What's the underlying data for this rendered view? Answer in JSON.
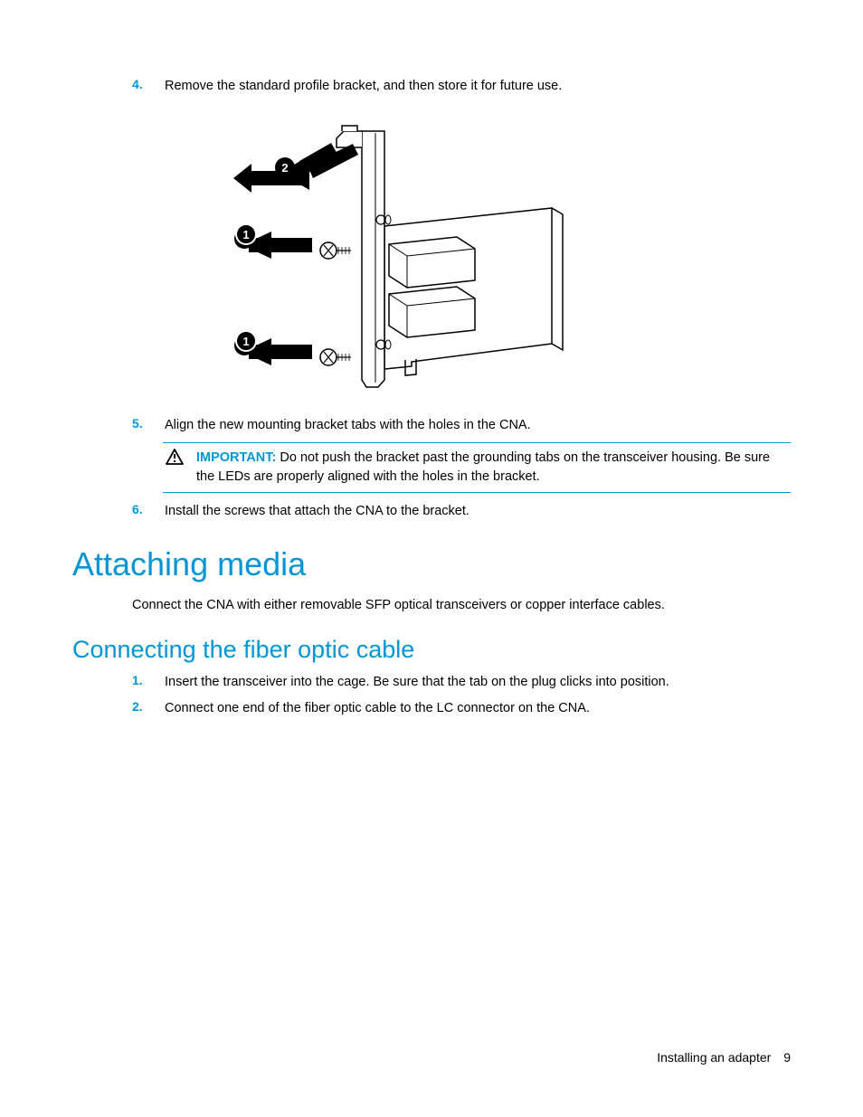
{
  "steps": {
    "step4": {
      "number": "4.",
      "text": "Remove the standard profile bracket, and then store it for future use."
    },
    "step5": {
      "number": "5.",
      "text": "Align the new mounting bracket tabs with the holes in the CNA."
    },
    "step6": {
      "number": "6.",
      "text": "Install the screws that attach the CNA to the bracket."
    }
  },
  "note": {
    "label": "IMPORTANT:",
    "text": "Do not push the bracket past the grounding tabs on the transceiver housing. Be sure the LEDs are properly aligned with the holes in the bracket."
  },
  "heading1": "Attaching media",
  "body1": "Connect the CNA with either removable SFP optical transceivers or copper interface cables.",
  "heading2": "Connecting the fiber optic cable",
  "substeps": {
    "step1": {
      "number": "1.",
      "text": "Insert the transceiver into the cage. Be sure that the tab on the plug clicks into position."
    },
    "step2": {
      "number": "2.",
      "text": "Connect one end of the fiber optic cable to the LC connector on the CNA."
    }
  },
  "footer": {
    "section": "Installing an adapter",
    "page": "9"
  }
}
